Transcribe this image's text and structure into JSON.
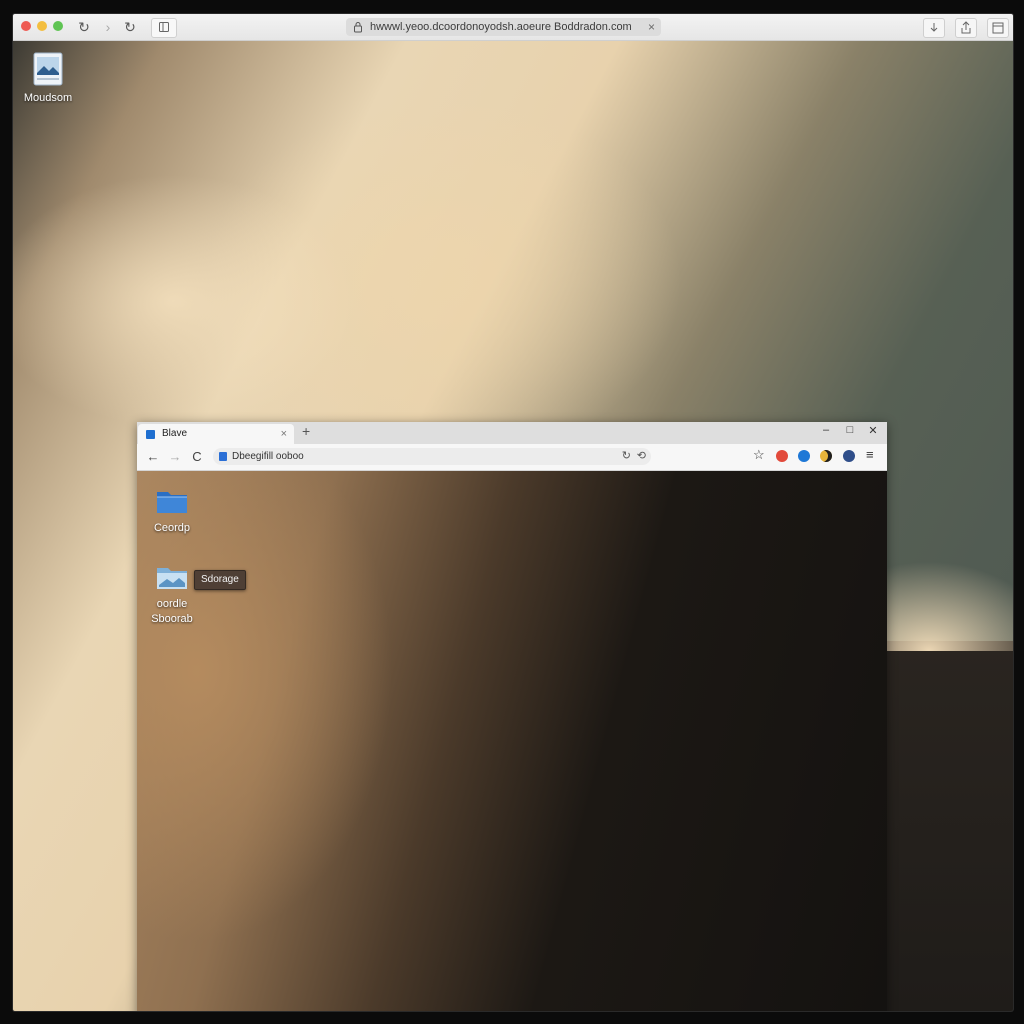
{
  "outer_browser": {
    "address_url": "hwwwl.yeoo.dcoordonoyodsh.aoeure Boddradon.com",
    "address_close_label": "×"
  },
  "desktop": {
    "top_icon_label": "Moudsom"
  },
  "inner_browser": {
    "tab_title": "Blave",
    "tab_close_label": "×",
    "new_tab_label": "+",
    "minimize_label": "–",
    "maximize_label": "□",
    "close_label": "✕",
    "back_label": "←",
    "forward_label": "→",
    "reload_label": "C",
    "address_text": "Dbeegifill ooboo",
    "menu_label": "≡",
    "star_label": "☆"
  },
  "inner_desktop": {
    "folder1_label": "Ceordp",
    "folder2_label_line1": "oordle",
    "folder2_label_line2": "Sboorab",
    "tooltip_text": "Sdorage"
  },
  "colors": {
    "tab_favicon": "#1f6fd0",
    "ext_red": "#e24a3b",
    "ext_blue": "#1e78d6",
    "ext_yellow": "#e7b43a",
    "ext_navy": "#2f4e8a"
  },
  "icons": {
    "lock": "lock-icon",
    "share": "share-icon",
    "tabs": "tabs-icon",
    "folder": "folder-icon",
    "image_file": "image-file-icon"
  }
}
